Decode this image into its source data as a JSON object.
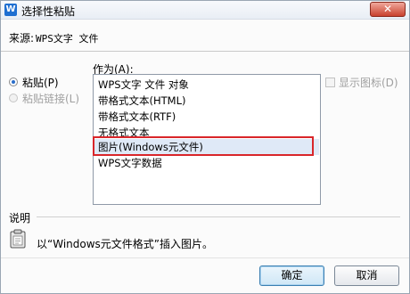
{
  "window": {
    "title": "选择性粘贴",
    "app_icon_letter": "W",
    "close_glyph": "✕"
  },
  "source": {
    "label": "来源:",
    "value": "WPS文字 文件"
  },
  "paste_options": {
    "as_label": "作为(A):",
    "radios": [
      {
        "label": "粘贴(P)",
        "checked": true,
        "enabled": true
      },
      {
        "label": "粘贴链接(L)",
        "checked": false,
        "enabled": false
      }
    ],
    "formats": [
      {
        "label": "WPS文字 文件 对象",
        "selected": false
      },
      {
        "label": "带格式文本(HTML)",
        "selected": false
      },
      {
        "label": "带格式文本(RTF)",
        "selected": false
      },
      {
        "label": "无格式文本",
        "selected": false
      },
      {
        "label": "图片(Windows元文件)",
        "selected": true
      },
      {
        "label": "WPS文字数据",
        "selected": false
      }
    ],
    "show_as_icon": {
      "label": "显示图标(D)",
      "checked": false,
      "enabled": false
    }
  },
  "description": {
    "label": "说明",
    "text": "以“Windows元文件格式”插入图片。"
  },
  "buttons": {
    "ok": "确定",
    "cancel": "取消"
  },
  "colors": {
    "selection": "#dfe9f7",
    "highlight_border": "#d9262a",
    "close_button": "#c8412d"
  }
}
